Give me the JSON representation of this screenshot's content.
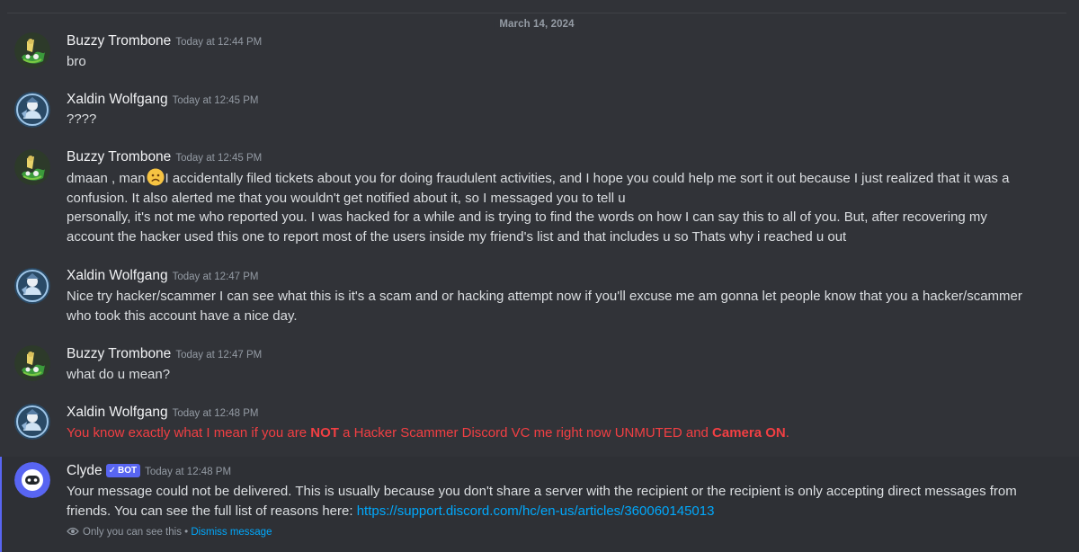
{
  "date_divider": "March 14, 2024",
  "messages": [
    {
      "author": "Buzzy Trombone",
      "timestamp": "Today at 12:44 PM",
      "text": "bro"
    },
    {
      "author": "Xaldin Wolfgang",
      "timestamp": "Today at 12:45 PM",
      "text": "????"
    },
    {
      "author": "Buzzy Trombone",
      "timestamp": "Today at 12:45 PM",
      "text_pre": "dmaan , man",
      "emoji": "frowning-face",
      "text_line1": "I accidentally filed tickets about you for doing fraudulent activities, and I hope you could help me sort it out because I just realized that it was a",
      "text_line2": "confusion. It also alerted me that you wouldn't get notified about it, so I messaged you to tell u",
      "text_line3": "personally, it's not me who reported you. I was hacked for a while and is trying to find the words on how I can say this to all of you. But, after  recovering my",
      "text_line4": "account the hacker used this one to report most of the users inside my friend's list and that includes u so Thats why i reached u out"
    },
    {
      "author": "Xaldin Wolfgang",
      "timestamp": "Today at 12:47 PM",
      "text_line1": "Nice try hacker/scammer I can see what this is it's a scam and or hacking attempt now if you'll excuse me am gonna let people know that you a hacker/scammer",
      "text_line2": "who took this account have a nice day."
    },
    {
      "author": "Buzzy Trombone",
      "timestamp": "Today at 12:47 PM",
      "text": "what do u mean?"
    },
    {
      "author": "Xaldin Wolfgang",
      "timestamp": "Today at 12:48 PM",
      "text_a": "You know exactly what I mean if you are ",
      "text_b": "NOT",
      "text_c": " a Hacker Scammer Discord VC me right now UNMUTED and ",
      "text_d": "Camera ON",
      "text_e": ".",
      "text_color": "#f23f43"
    },
    {
      "author": "Clyde",
      "badge_check": "✓",
      "badge": "BOT",
      "timestamp": "Today at 12:48 PM",
      "text_line1": "Your message could not be delivered. This is usually because you don't share a server with the recipient or the recipient is only accepting direct messages from",
      "text_line2": "friends. You can see the full list of reasons here: ",
      "link": "https://support.discord.com/hc/en-us/articles/360060145013",
      "ephemeral_note": "Only you can see this",
      "ephemeral_sep": " • ",
      "dismiss_label": "Dismiss message"
    }
  ],
  "colors": {
    "background": "#313338",
    "clyde_highlight": "#2e3035",
    "accent": "#5865f2",
    "link": "#00a8fc",
    "red_text": "#f23f43"
  },
  "icons": {
    "buzzy_avatar": "green-trombone-avatar",
    "xaldin_avatar": "blue-character-avatar",
    "clyde_avatar": "clyde-bot-avatar",
    "emoji": "frowning-face-emoji",
    "eye": "eye-icon"
  }
}
